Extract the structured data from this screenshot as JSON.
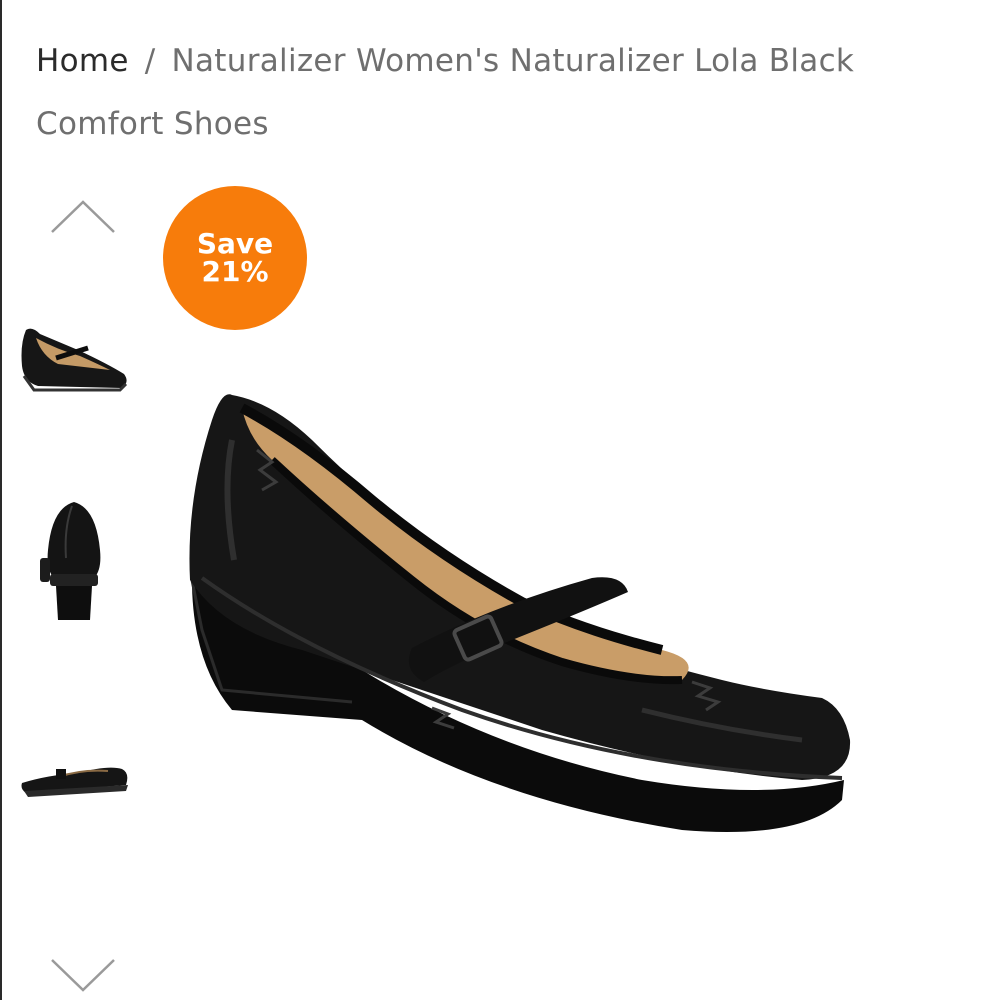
{
  "breadcrumb": {
    "home_label": "Home",
    "separator": "/",
    "current_label": "Naturalizer Women's Naturalizer Lola Black Comfort Shoes"
  },
  "thumbnails": {
    "prev_icon": "chevron-up-icon",
    "next_icon": "chevron-down-icon",
    "items": [
      {
        "view": "side view shoe thumbnail"
      },
      {
        "view": "back view shoe thumbnail"
      },
      {
        "view": "profile view shoe thumbnail"
      }
    ]
  },
  "badge": {
    "line1": "Save",
    "line2": "21%",
    "color": "#f77c0b"
  },
  "colors": {
    "leather": "#151515",
    "lining": "#c9a06a",
    "sole": "#0c0c0c"
  }
}
